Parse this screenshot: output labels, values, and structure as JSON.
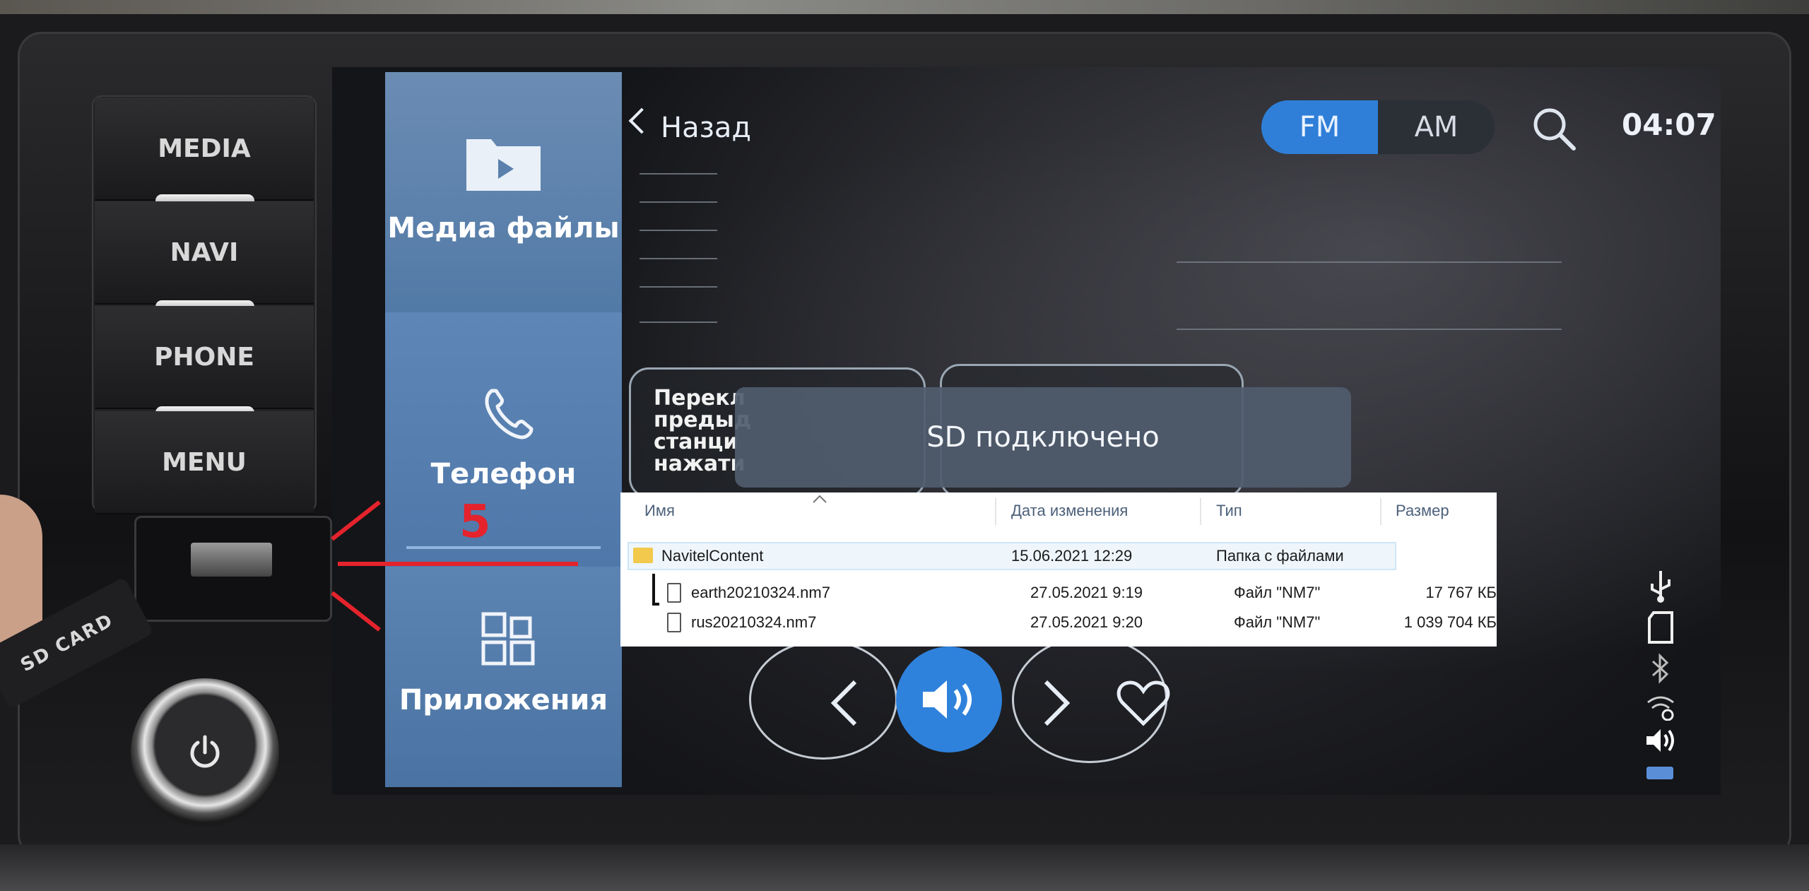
{
  "hardware": {
    "media": "MEDIA",
    "navi": "NAVI",
    "phone": "PHONE",
    "menu": "MENU",
    "sd_card": "SD CARD"
  },
  "sidebar": {
    "items": [
      {
        "label": "Медиа файлы",
        "icon": "folder-play-icon",
        "active": true
      },
      {
        "label": "Телефон",
        "icon": "phone-icon"
      },
      {
        "label": "Приложения",
        "icon": "apps-grid-icon"
      }
    ]
  },
  "topbar": {
    "back_label": "Назад",
    "band_fm": "FM",
    "band_am": "AM",
    "clock": "04:07"
  },
  "preset": {
    "text": "Перекл предыд станци нажати"
  },
  "toast": {
    "message": "SD подключено"
  },
  "explorer": {
    "columns": [
      "Имя",
      "Дата изменения",
      "Тип",
      "Размер"
    ],
    "rows": [
      {
        "name": "NavitelContent",
        "date": "15.06.2021 12:29",
        "type": "Папка с файлами",
        "size": ""
      },
      {
        "name": "earth20210324.nm7",
        "date": "27.05.2021 9:19",
        "type": "Файл \"NM7\"",
        "size": "17 767 КБ"
      },
      {
        "name": "rus20210324.nm7",
        "date": "27.05.2021 9:20",
        "type": "Файл \"NM7\"",
        "size": "1 039 704 КБ"
      }
    ]
  },
  "annotation": {
    "step": "5"
  },
  "colors": {
    "accent": "#2f82dc",
    "sidebar": "#527aa6",
    "annotation": "#e5232c"
  }
}
